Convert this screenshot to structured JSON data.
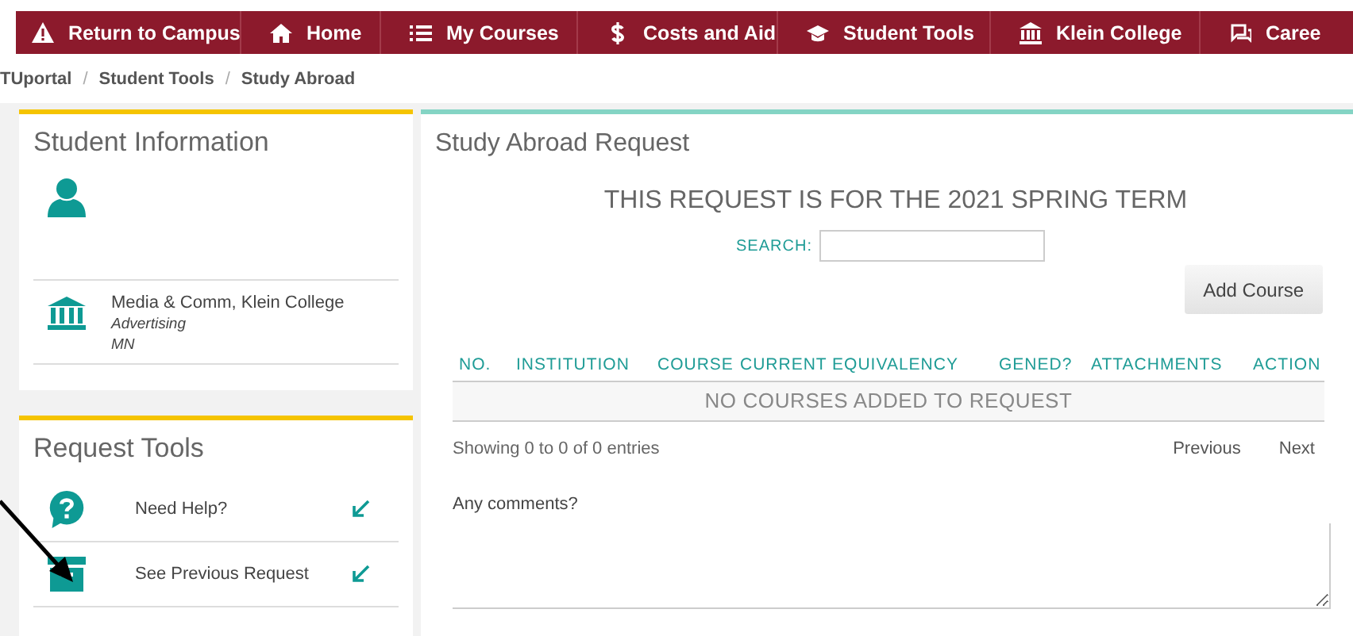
{
  "nav": [
    {
      "label": "Return to Campus",
      "kind": "warning"
    },
    {
      "label": "Home",
      "kind": "home"
    },
    {
      "label": "My Courses",
      "kind": "list"
    },
    {
      "label": "Costs and Aid",
      "kind": "dollar"
    },
    {
      "label": "Student Tools",
      "kind": "cap"
    },
    {
      "label": "Klein College",
      "kind": "bank"
    },
    {
      "label": "Caree",
      "kind": "chat"
    }
  ],
  "breadcrumb": [
    {
      "label": "TUportal",
      "separator": "/"
    },
    {
      "label": "Student Tools",
      "separator": "/"
    },
    {
      "label": "Study Abroad"
    }
  ],
  "student_info": {
    "title": "Student Information",
    "college": "Media & Comm, Klein College",
    "major": "Advertising",
    "level": "MN"
  },
  "request_tools": {
    "title": "Request Tools",
    "items": [
      {
        "label": "Need Help?",
        "kind": "question"
      },
      {
        "label": "See Previous Request",
        "kind": "archive"
      }
    ]
  },
  "request": {
    "title": "Study Abroad Request",
    "term": "THIS REQUEST IS FOR THE 2021 SPRING TERM",
    "search_label": "SEARCH:",
    "add_button": "Add Course",
    "columns": [
      "NO.",
      "INSTITUTION",
      "COURSE",
      "CURRENT EQUIVALENCY",
      "GENED?",
      "ATTACHMENTS",
      "ACTION"
    ],
    "empty": "NO COURSES ADDED TO REQUEST",
    "info": "Showing 0 to 0 of 0 entries",
    "previous": "Previous",
    "next": "Next",
    "comments_label": "Any comments?"
  }
}
